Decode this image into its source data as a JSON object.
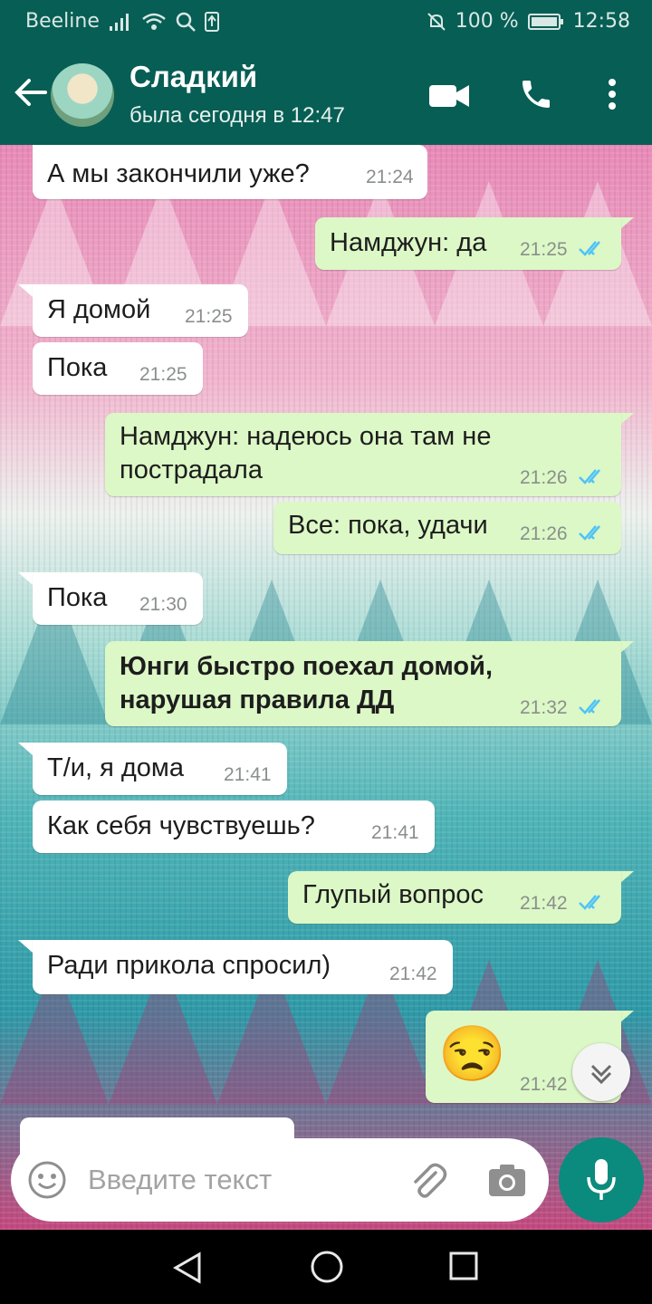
{
  "status_bar": {
    "carrier": "Beeline",
    "battery": "100 %",
    "time": "12:58"
  },
  "header": {
    "contact_name": "Сладкий",
    "last_seen": "была сегодня в 12:47"
  },
  "messages": [
    {
      "dir": "in",
      "text": "А мы закончили уже?",
      "time": "21:24"
    },
    {
      "dir": "out",
      "text": "Намджун: да",
      "time": "21:25"
    },
    {
      "dir": "in",
      "text": "Я домой",
      "time": "21:25"
    },
    {
      "dir": "in",
      "text": "Пока",
      "time": "21:25"
    },
    {
      "dir": "out",
      "text": "Намджун: надеюсь она там не\nпострадала",
      "time": "21:26"
    },
    {
      "dir": "out",
      "text": "Все: пока, удачи",
      "time": "21:26"
    },
    {
      "dir": "in",
      "text": "Пока",
      "time": "21:30"
    },
    {
      "dir": "out",
      "text": "Юнги быстро поехал домой,\nнарушая правила ДД",
      "time": "21:32"
    },
    {
      "dir": "in",
      "text": "Т/и, я дома",
      "time": "21:41"
    },
    {
      "dir": "in",
      "text": "Как себя чувствуешь?",
      "time": "21:41"
    },
    {
      "dir": "out",
      "text": "Глупый вопрос",
      "time": "21:42"
    },
    {
      "dir": "in",
      "text": "Ради прикола спросил)",
      "time": "21:42"
    },
    {
      "dir": "out",
      "text": "😒",
      "time": "21:42"
    }
  ],
  "input": {
    "placeholder": "Введите текст"
  },
  "colors": {
    "header": "#075e54",
    "outgoing": "#dcf8c6",
    "incoming": "#ffffff",
    "tick": "#4fc3f7",
    "mic": "#0a8b7d"
  }
}
